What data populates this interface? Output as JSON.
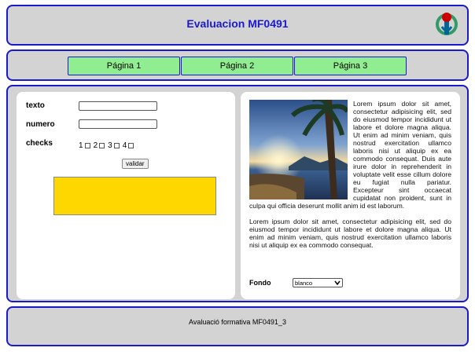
{
  "header": {
    "title": "Evaluacion MF0491",
    "logo_icon": "wikimedia-logo-icon"
  },
  "nav": {
    "tabs": [
      {
        "label": "Página 1"
      },
      {
        "label": "Página 2"
      },
      {
        "label": "Página 3"
      }
    ]
  },
  "form": {
    "texto_label": "texto",
    "texto_value": "",
    "numero_label": "numero",
    "numero_value": "",
    "checks_label": "checks",
    "checks": [
      {
        "num": "1",
        "checked": false
      },
      {
        "num": "2",
        "checked": false
      },
      {
        "num": "3",
        "checked": false
      },
      {
        "num": "4",
        "checked": false
      }
    ],
    "validar_label": "validar",
    "result_color": "#ffd700"
  },
  "article": {
    "image_icon": "tropical-sunset-photo",
    "para1": "Lorem ipsum dolor sit amet, consectetur adipisicing elit, sed do eiusmod tempor incididunt ut labore et dolore magna aliqua. Ut enim ad minim veniam, quis nostrud exercitation ullamco laboris nisi ut aliquip ex ea commodo consequat. Duis aute irure dolor in reprehenderit in voluptate velit esse cillum dolore eu fugiat nulla pariatur. Excepteur sint occaecat cupidatat non proident, sunt in culpa qui officia deserunt mollit anim id est laborum.",
    "para2": "Lorem ipsum dolor sit amet, consectetur adipisicing elit, sed do eiusmod tempor incididunt ut labore et dolore magna aliqua. Ut enim ad minim veniam, quis nostrud exercitation ullamco laboris nisi ut aliquip ex ea commodo consequat.",
    "fondo_label": "Fondo",
    "fondo_selected": "blanco"
  },
  "footer": {
    "text": "Avaluació formativa MF0491_3"
  },
  "colors": {
    "border": "#1a1acc",
    "tab": "#90ee90",
    "panel_bg": "#d3d3d3",
    "title": "#1a1acc"
  }
}
